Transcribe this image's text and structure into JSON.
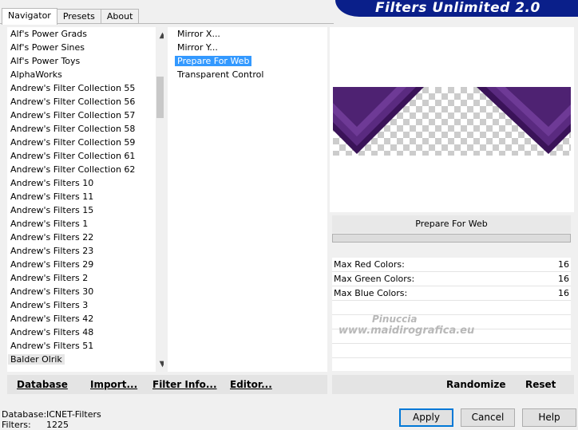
{
  "tabs": [
    "Navigator",
    "Presets",
    "About"
  ],
  "banner_title": "Filters Unlimited 2.0",
  "categories": [
    "Alf's Power Grads",
    "Alf's Power Sines",
    "Alf's Power Toys",
    "AlphaWorks",
    "Andrew's Filter Collection 55",
    "Andrew's Filter Collection 56",
    "Andrew's Filter Collection 57",
    "Andrew's Filter Collection 58",
    "Andrew's Filter Collection 59",
    "Andrew's Filter Collection 61",
    "Andrew's Filter Collection 62",
    "Andrew's Filters 10",
    "Andrew's Filters 11",
    "Andrew's Filters 15",
    "Andrew's Filters 1",
    "Andrew's Filters 22",
    "Andrew's Filters 23",
    "Andrew's Filters 29",
    "Andrew's Filters 2",
    "Andrew's Filters 30",
    "Andrew's Filters 3",
    "Andrew's Filters 42",
    "Andrew's Filters 48",
    "Andrew's Filters 51",
    "Balder Olrik"
  ],
  "filters": [
    "Mirror X...",
    "Mirror Y...",
    "Prepare For Web",
    "Transparent Control"
  ],
  "selected_filter": "Prepare For Web",
  "params": [
    {
      "label": "Max Red Colors:",
      "value": "16"
    },
    {
      "label": "Max Green Colors:",
      "value": "16"
    },
    {
      "label": "Max Blue Colors:",
      "value": "16"
    }
  ],
  "watermark": {
    "line1": "Pinuccia",
    "line2": "www.maidirografica.eu"
  },
  "left_buttons": {
    "database": "Database",
    "import": "Import...",
    "filter_info": "Filter Info...",
    "editor": "Editor..."
  },
  "right_buttons": {
    "randomize": "Randomize",
    "reset": "Reset"
  },
  "status": {
    "db_label": "Database:",
    "db_value": "ICNET-Filters",
    "filters_label": "Filters:",
    "filters_value": "1225"
  },
  "dialog_buttons": {
    "apply": "Apply",
    "cancel": "Cancel",
    "help": "Help"
  },
  "colors": {
    "banner": "#0a1f8a",
    "selection": "#3399ff",
    "preview_purple": "#4a1f6e"
  },
  "icons": {
    "scroll_up": "▲",
    "scroll_down": "▼"
  }
}
